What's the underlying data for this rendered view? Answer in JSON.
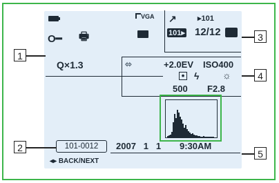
{
  "callouts": [
    "1",
    "2",
    "3",
    "4",
    "5"
  ],
  "panel1": {
    "battery_icon": "battery-icon",
    "image_size": "VGA",
    "lock_icon": "protect-key-icon",
    "print_icon": "print-order-icon",
    "folder_icon": "folder-icon",
    "zoom_icon": "zoom-magnifier-icon",
    "zoom": "×1.3"
  },
  "panel3": {
    "folder_top": "101",
    "folder_num": "101",
    "count": "12/12",
    "mode_icon": "camera-mode-icon"
  },
  "panel4": {
    "exposure": "+2.0EV",
    "iso": "ISO400",
    "shutter": "500",
    "aperture": "F2.8",
    "icons": [
      "memory-stick-icon",
      "metering-spot-icon",
      "flash-icon",
      "white-balance-icon"
    ]
  },
  "panel2": {
    "file_number": "101-0012"
  },
  "panel5": {
    "date": "2007   1   1",
    "time": "9:30AM",
    "nav": "BACK/NEXT"
  },
  "colors": {
    "accent_green": "#3cb54a",
    "screen": "#e3eef8",
    "ink": "#1e2a35"
  }
}
